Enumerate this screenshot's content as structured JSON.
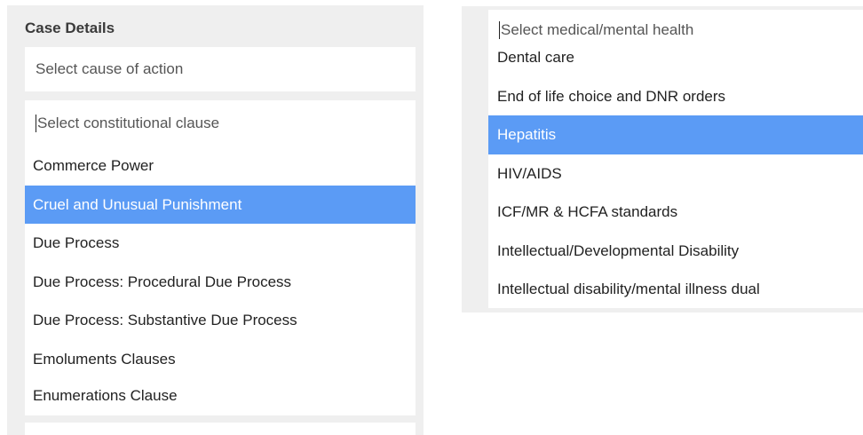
{
  "case_details": {
    "title": "Case Details",
    "cause_of_action_placeholder": "Select cause of action",
    "constitutional_clause": {
      "placeholder": "Select constitutional clause",
      "options": [
        {
          "label": "Commerce Power",
          "selected": false
        },
        {
          "label": "Cruel and Unusual Punishment",
          "selected": true
        },
        {
          "label": "Due Process",
          "selected": false
        },
        {
          "label": "Due Process: Procedural Due Process",
          "selected": false
        },
        {
          "label": "Due Process: Substantive Due Process",
          "selected": false
        },
        {
          "label": "Emoluments Clauses",
          "selected": false
        },
        {
          "label": "Enumerations Clause",
          "selected": false
        }
      ]
    }
  },
  "medical_mental_health": {
    "placeholder": "Select medical/mental health",
    "options": [
      {
        "label": "Dental care",
        "selected": false
      },
      {
        "label": "End of life choice and DNR orders",
        "selected": false
      },
      {
        "label": "Hepatitis",
        "selected": true
      },
      {
        "label": "HIV/AIDS",
        "selected": false
      },
      {
        "label": "ICF/MR & HCFA standards",
        "selected": false
      },
      {
        "label": "Intellectual/Developmental Disability",
        "selected": false
      },
      {
        "label": "Intellectual disability/mental illness dual",
        "selected": false
      }
    ]
  },
  "colors": {
    "highlight": "#5b9bf5",
    "panel_bg": "#efefef"
  }
}
